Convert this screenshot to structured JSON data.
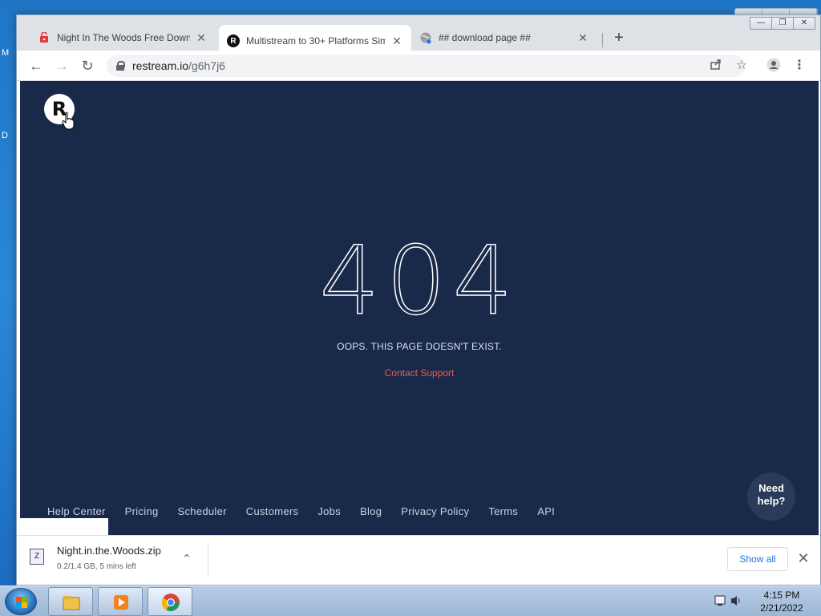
{
  "desktop": {
    "letters": [
      "M",
      "D"
    ]
  },
  "tabs": [
    {
      "title": "Night In The Woods Free Downlo",
      "favicon": "malware-shield-icon"
    },
    {
      "title": "Multistream to 30+ Platforms Sim",
      "favicon": "restream-logo-icon"
    },
    {
      "title": "## download page ##",
      "favicon": "globe-icon"
    }
  ],
  "toolbar": {
    "url_host": "restream.io",
    "url_path": "/g6h7j6"
  },
  "page": {
    "logo_letter": "R",
    "error_code": "404",
    "message": "OOPS. THIS PAGE DOESN'T EXIST.",
    "support_link": "Contact Support",
    "footer_links": [
      "Help Center",
      "Pricing",
      "Scheduler",
      "Customers",
      "Jobs",
      "Blog",
      "Privacy Policy",
      "Terms",
      "API"
    ],
    "help_bubble_line1": "Need",
    "help_bubble_line2": "help?"
  },
  "download": {
    "file_name": "Night.in.the.Woods.zip",
    "status": "0.2/1.4 GB, 5 mins left",
    "show_all": "Show all"
  },
  "taskbar": {
    "time": "4:15 PM",
    "date": "2/21/2022"
  },
  "colors": {
    "page_bg": "#19294a",
    "support_link": "#ef5d4a",
    "accent_blue": "#1a73e8"
  }
}
